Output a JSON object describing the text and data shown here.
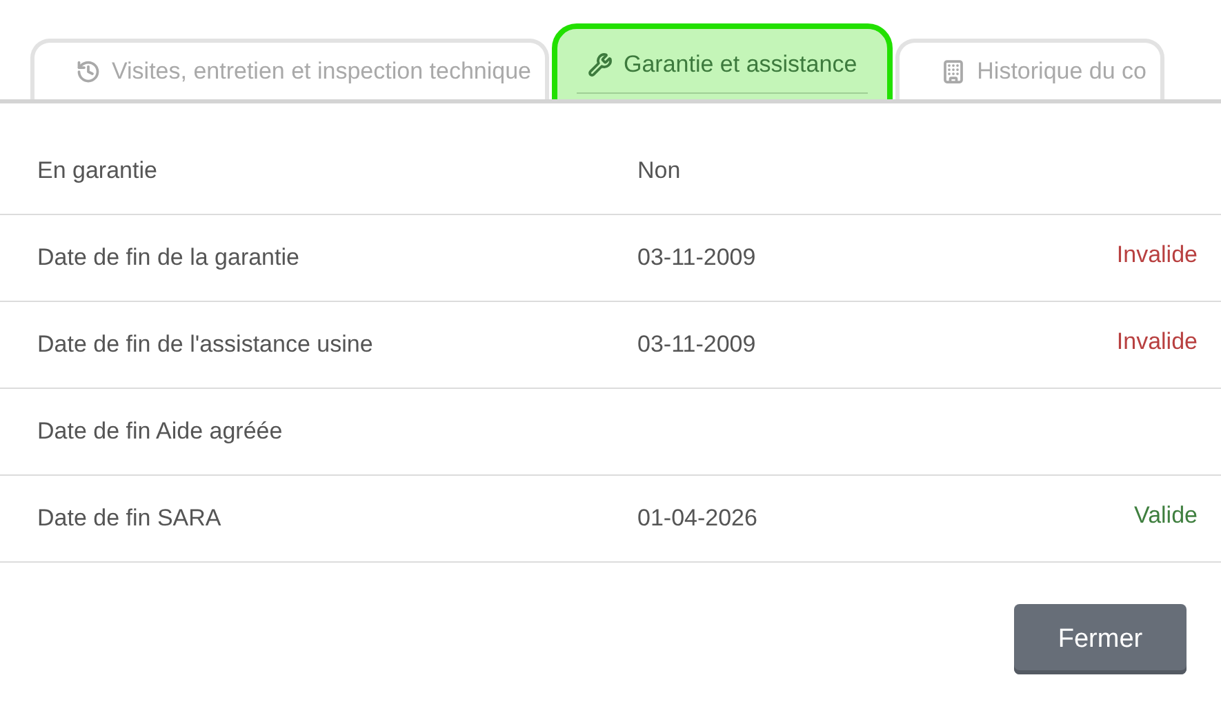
{
  "tabs": [
    {
      "label": "Visites, entretien et inspection technique",
      "kind": "history",
      "selected": false
    },
    {
      "label": "Garantie et assistance",
      "kind": "tools",
      "selected": true
    },
    {
      "label": "Historique du co",
      "kind": "building",
      "selected": false
    }
  ],
  "rows": [
    {
      "label": "En garantie",
      "value": "Non"
    },
    {
      "label": "Date de fin de la garantie",
      "value": "03-11-2009",
      "status": {
        "text": "Invalide",
        "valid": false
      }
    },
    {
      "label": "Date de fin de l'assistance usine",
      "value": "03-11-2009",
      "status": {
        "text": "Invalide",
        "valid": false
      }
    },
    {
      "label": "Date de fin Aide agréée"
    },
    {
      "label": "Date de fin SARA",
      "value": "01-04-2026",
      "status": {
        "text": "Valide",
        "valid": true
      }
    }
  ],
  "buttons": [
    "Fermer"
  ]
}
